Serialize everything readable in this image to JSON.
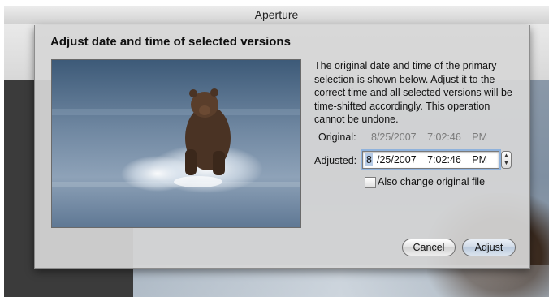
{
  "window": {
    "title": "Aperture"
  },
  "dialog": {
    "title": "Adjust date and time of selected versions",
    "description": "The original date and time of the primary selection is shown below. Adjust it to the correct time and all selected versions will be time-shifted accordingly. This operation cannot be undone.",
    "original_label": "Original:",
    "original_value": "8/25/2007 7:02:46 PM",
    "adjusted_label": "Adjusted:",
    "adjusted_month": "8",
    "adjusted_rest": "/25/2007 7:02:46 PM",
    "stepper_icon": "stepper-arrows-icon",
    "checkbox_label": "Also change original file",
    "checkbox_checked": false,
    "cancel_label": "Cancel",
    "adjust_label": "Adjust"
  },
  "preview": {
    "subject": "bear-photo-icon"
  }
}
